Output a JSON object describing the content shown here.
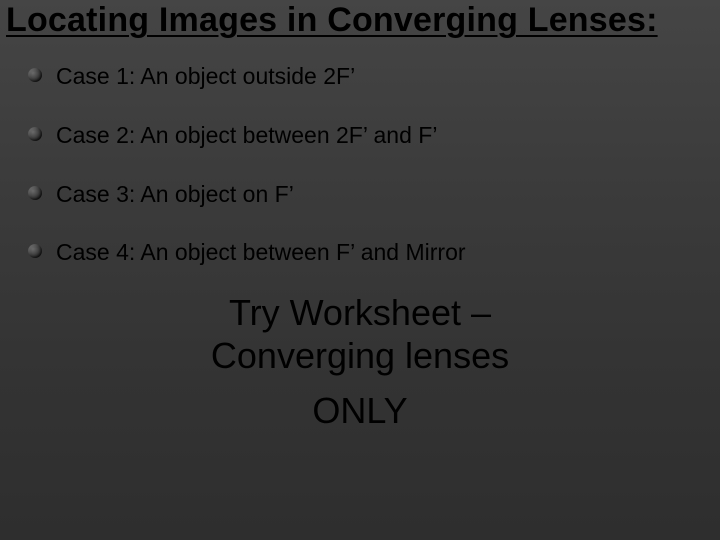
{
  "title": "Locating Images in Converging Lenses:",
  "cases": [
    "Case 1: An object outside 2F’",
    "Case 2: An object between 2F’ and F’",
    "Case 3: An object on F’",
    "Case 4: An object between F’ and Mirror"
  ],
  "callout_line1": "Try Worksheet –",
  "callout_line2": "Converging lenses",
  "callout_line3": "ONLY"
}
